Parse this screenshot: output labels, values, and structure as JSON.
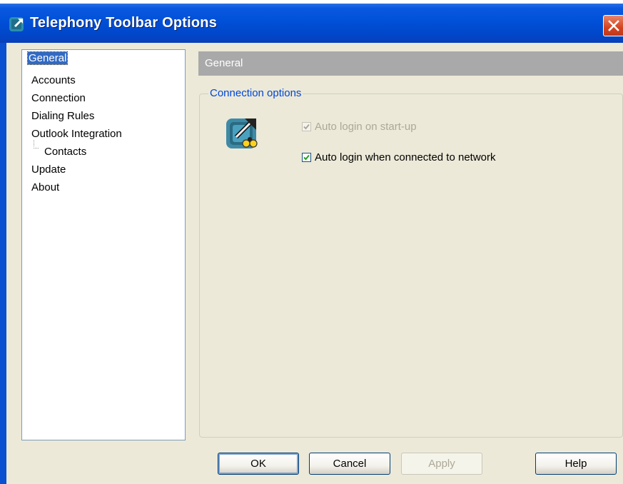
{
  "window": {
    "title": "Telephony Toolbar Options",
    "icon": "telephony-app-icon",
    "close_icon": "close-icon"
  },
  "sidebar": {
    "items": [
      {
        "label": "General",
        "selected": true
      },
      {
        "label": "Accounts"
      },
      {
        "label": "Connection"
      },
      {
        "label": "Dialing Rules"
      },
      {
        "label": "Outlook Integration"
      },
      {
        "label": "Contacts",
        "child": true
      },
      {
        "label": "Update"
      },
      {
        "label": "About"
      }
    ]
  },
  "page": {
    "header": "General",
    "group_title": "Connection options",
    "options": [
      {
        "label": "Auto login on start-up",
        "checked": true,
        "disabled": true
      },
      {
        "label": "Auto login when connected to network",
        "checked": true,
        "disabled": false
      }
    ]
  },
  "buttons": {
    "ok": "OK",
    "cancel": "Cancel",
    "apply": "Apply",
    "help": "Help"
  },
  "colors": {
    "titlebar": "#0050d8",
    "selection": "#316ac5",
    "header_band": "#a9a9a9",
    "group_title": "#0046d5",
    "close_button": "#d44320"
  }
}
